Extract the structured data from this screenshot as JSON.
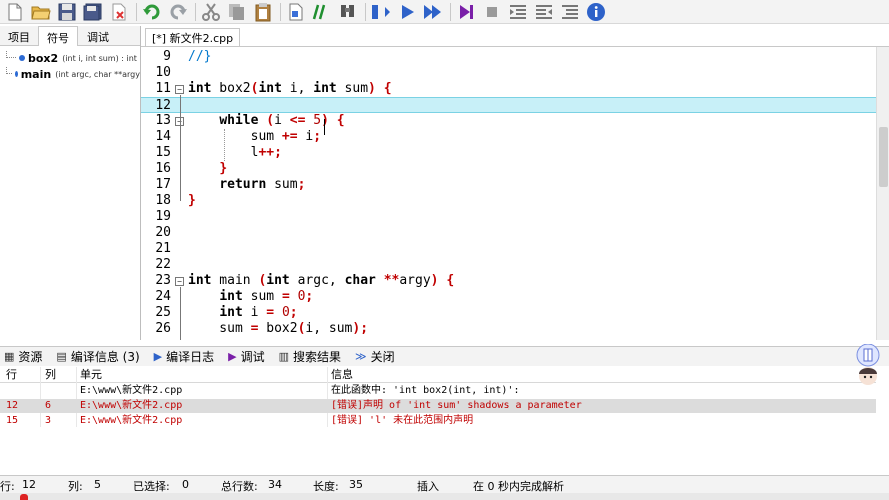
{
  "toolbar": {
    "icons": [
      "new-file-icon",
      "open-folder-icon",
      "save-icon",
      "save-all-icon",
      "close-file-icon",
      "undo-icon",
      "redo-icon",
      "cut-icon",
      "copy-icon",
      "paste-icon",
      "indent-icon",
      "comment-icon",
      "find-icon",
      "compile-icon",
      "run-icon",
      "compile-run-icon",
      "debug-icon",
      "stop-icon",
      "outdent-icon",
      "format-icon",
      "toggle-icon",
      "info-icon"
    ]
  },
  "left_panel": {
    "tabs": [
      "项目",
      "符号",
      "调试"
    ],
    "symbols": [
      {
        "name": "box2",
        "signature": "(int i, int sum) : int"
      },
      {
        "name": "main",
        "signature": "(int argc, char **argy"
      }
    ]
  },
  "file_tab": "[*] 新文件2.cpp",
  "editor": {
    "current_line": "12",
    "lines": [
      {
        "no": "9",
        "text": "//}"
      },
      {
        "no": "10",
        "text": ""
      },
      {
        "no": "11",
        "text": "int box2(int i, int sum) {"
      },
      {
        "no": "12",
        "text": ""
      },
      {
        "no": "13",
        "text": "while (i <= 5) {"
      },
      {
        "no": "14",
        "text": "sum += i;"
      },
      {
        "no": "15",
        "text": "l++;"
      },
      {
        "no": "16",
        "text": "}"
      },
      {
        "no": "17",
        "text": "return sum;"
      },
      {
        "no": "18",
        "text": "}"
      },
      {
        "no": "19",
        "text": ""
      },
      {
        "no": "20",
        "text": ""
      },
      {
        "no": "21",
        "text": ""
      },
      {
        "no": "22",
        "text": ""
      },
      {
        "no": "23",
        "text": "int main (int argc, char **argy) {"
      },
      {
        "no": "24",
        "text": "int sum = 0;"
      },
      {
        "no": "25",
        "text": "int i = 0;"
      },
      {
        "no": "26",
        "text": "sum = box2(i, sum);"
      }
    ]
  },
  "bottom_tabs": [
    {
      "icon": "resources-icon",
      "label": "资源"
    },
    {
      "icon": "compile-info-icon",
      "label": "编译信息 (3)"
    },
    {
      "icon": "compile-log-icon",
      "label": "编译日志"
    },
    {
      "icon": "debug-tab-icon",
      "label": "调试"
    },
    {
      "icon": "search-results-icon",
      "label": "搜索结果"
    },
    {
      "icon": "close-icon",
      "label": "关闭"
    }
  ],
  "messages": {
    "headers": {
      "row": "行",
      "col": "列",
      "unit": "单元",
      "info": "信息"
    },
    "rows": [
      {
        "row": "",
        "col": "",
        "unit": "E:\\www\\新文件2.cpp",
        "info": "在此函数中:  'int box2(int, int)':",
        "error": false,
        "selected": false
      },
      {
        "row": "12",
        "col": "6",
        "unit": "E:\\www\\新文件2.cpp",
        "info": "[错误]声明 of 'int sum' shadows a parameter",
        "error": true,
        "selected": true
      },
      {
        "row": "15",
        "col": "3",
        "unit": "E:\\www\\新文件2.cpp",
        "info": "[错误] 'l' 未在此范围内声明",
        "error": true,
        "selected": false
      }
    ]
  },
  "status": {
    "row_label": "行:",
    "row_value": "12",
    "col_label": "列:",
    "col_value": "5",
    "selected_label": "已选择:",
    "selected_value": "0",
    "total_label": "总行数:",
    "total_value": "34",
    "length_label": "长度:",
    "length_value": "35",
    "mode": "插入",
    "parse_msg": "在 0 秒内完成解析"
  }
}
